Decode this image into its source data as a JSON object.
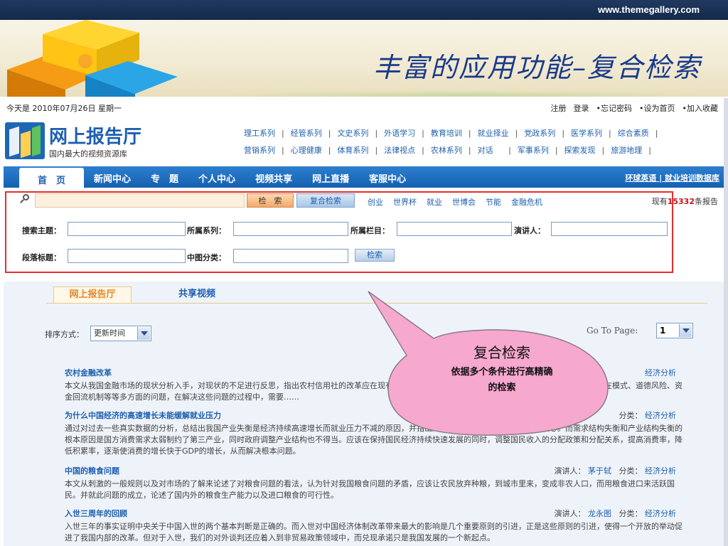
{
  "slide": {
    "url": "www.themegallery.com",
    "title": "丰富的应用功能–复合检索"
  },
  "site": {
    "date": "今天是 2010年07月26日 星期一",
    "top_links": [
      "注册",
      "登录",
      "•忘记密码",
      "•设为首页",
      "•加入收藏"
    ],
    "logo_name": "网上报告厅",
    "logo_sub": "国内最大的视频资源库",
    "categories_row1": [
      "理工系列",
      "经管系列",
      "文史系列",
      "外语学习",
      "教育培训",
      "就业择业",
      "党政系列",
      "医学系列",
      "综合素质"
    ],
    "categories_row2": [
      "营销系列",
      "心理健康",
      "体育系列",
      "法律视点",
      "农林系列",
      "对话",
      "军事系列",
      "探索发现",
      "旅游地理"
    ],
    "nav": [
      "首　页",
      "新闻中心",
      "专　题",
      "个人中心",
      "视频共享",
      "网上直播",
      "客服中心"
    ],
    "nav_right": "环球英语 | 就业培训数据库"
  },
  "search": {
    "button": "检　索",
    "advanced_button": "复合检索",
    "tags": [
      "创业",
      "世界杯",
      "就业",
      "世博会",
      "节能",
      "金融危机"
    ],
    "count_prefix": "现有",
    "count": "15332",
    "count_suffix": "条报告"
  },
  "advanced": {
    "topic_label": "搜索主题：",
    "series_label": "所属系列：",
    "column_label": "所属栏目：",
    "speaker_label": "演讲人：",
    "segment_label": "段落标题：",
    "class_label": "中图分类：",
    "submit": "检索"
  },
  "tabs": [
    "网上报告厅",
    "共享视频"
  ],
  "sort": {
    "label": "排序方式：",
    "value": "更新时间",
    "goto_label": "Go To Page:",
    "page": "1"
  },
  "articles": [
    {
      "title": "农村金融改革",
      "meta_key": "",
      "meta_val": "经济分析",
      "desc": "本文从我国金融市场的现状分析入手，对现状的不足进行反思，指出农村信用社的改革应在现有的基础上，深化产权制度改革，并指出农村金融体制改革还存在模式、道德风险、资金回流机制等等多方面的问题，在解决这些问题的过程中，需要……"
    },
    {
      "title": "为什么中国经济的高速增长未能缓解就业压力",
      "meta_key": "分类：",
      "meta_val": "经济分析",
      "desc": "通过对过去一些真实数据的分析，总结出我国产业失衡是经济持续高速增长而就业压力不减的原因，并指出产业结构调整是解决就业问题的核心。而需求结构失衡和产业结构失衡的根本原因是国方消费需求太弱制约了第三产业，同时政府调整产业结构也不得当。应该在保持国民经济持续快速发展的同时，调整国民收入的分配政策和分配关系，提高消费率，降低积累率，逐渐使消费的增长快于GDP的增长，从而解决根本问题。"
    },
    {
      "title": "中国的粮食问题",
      "meta_key": "演讲人：",
      "meta_person": "茅于轼",
      "meta_key2": "分类：",
      "meta_val": "经济分析",
      "desc": "本文从刺激的一般规则以及对市场的了解来论述了对粮食问题的看法，认为针对我国粮食问题的矛盾，应该让农民放弃种粮，到城市里来，变成非农人口，而用粮食进口来活跃国民。并就此问题的成立，论述了国内外的粮食生产能力以及进口粮食的可行性。"
    },
    {
      "title": "入世三周年的回顾",
      "meta_key": "演讲人：",
      "meta_person": "龙永图",
      "meta_key2": "分类：",
      "meta_val": "经济分析",
      "desc": "入世三年的事实证明中央关于中国入世的两个基本判断是正确的。而入世对中国经济体制改革带来最大的影响是几个重要原则的引进，正是这些原则的引进，使得一个开放的举动促进了我国内部的改革。但对于入世，我们的对外谈判还应着入到非贸易政策领域中，而兑现承诺只是我国发展的一个新起点。"
    }
  ],
  "callout": {
    "heading": "复合检索",
    "desc_line1": "依据多个条件进行高精确",
    "desc_line2": "的检索"
  },
  "colors": {
    "accent_blue": "#1e5fb0",
    "highlight_red": "#e52d2d",
    "bubble_pink": "#f7a8cf"
  }
}
